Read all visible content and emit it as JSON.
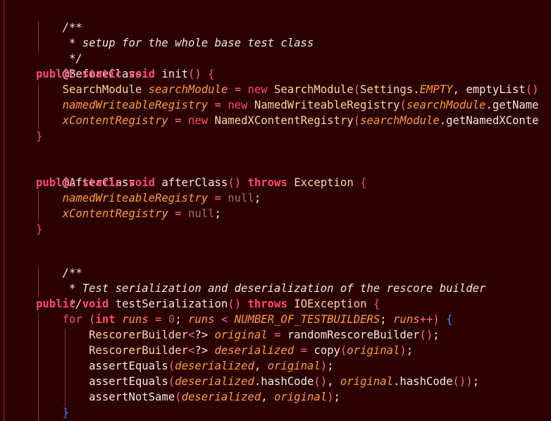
{
  "editor": {
    "background": "#2b0000",
    "margin_rule_color": "#c01818",
    "code_lines": [
      "/**",
      " * setup for the whole base test class",
      " */",
      "@BeforeClass",
      "public static void init() {",
      "    SearchModule searchModule = new SearchModule(Settings.EMPTY, emptyList()",
      "    namedWriteableRegistry = new NamedWriteableRegistry(searchModule.getName",
      "    xContentRegistry = new NamedXContentRegistry(searchModule.getNamedXConte",
      "}",
      "",
      "@AfterClass",
      "public static void afterClass() throws Exception {",
      "    namedWriteableRegistry = null;",
      "    xContentRegistry = null;",
      "}",
      "",
      "/**",
      " * Test serialization and deserialization of the rescore builder",
      " */",
      "public void testSerialization() throws IOException {",
      "    for (int runs = 0; runs < NUMBER_OF_TESTBUILDERS; runs++) {",
      "        RescorerBuilder<?> original = randomRescoreBuilder();",
      "        RescorerBuilder<?> deserialized = copy(original);",
      "        assertEquals(deserialized, original);",
      "        assertEquals(deserialized.hashCode(), original.hashCode());",
      "        assertNotSame(deserialized, original);",
      "    }"
    ]
  }
}
